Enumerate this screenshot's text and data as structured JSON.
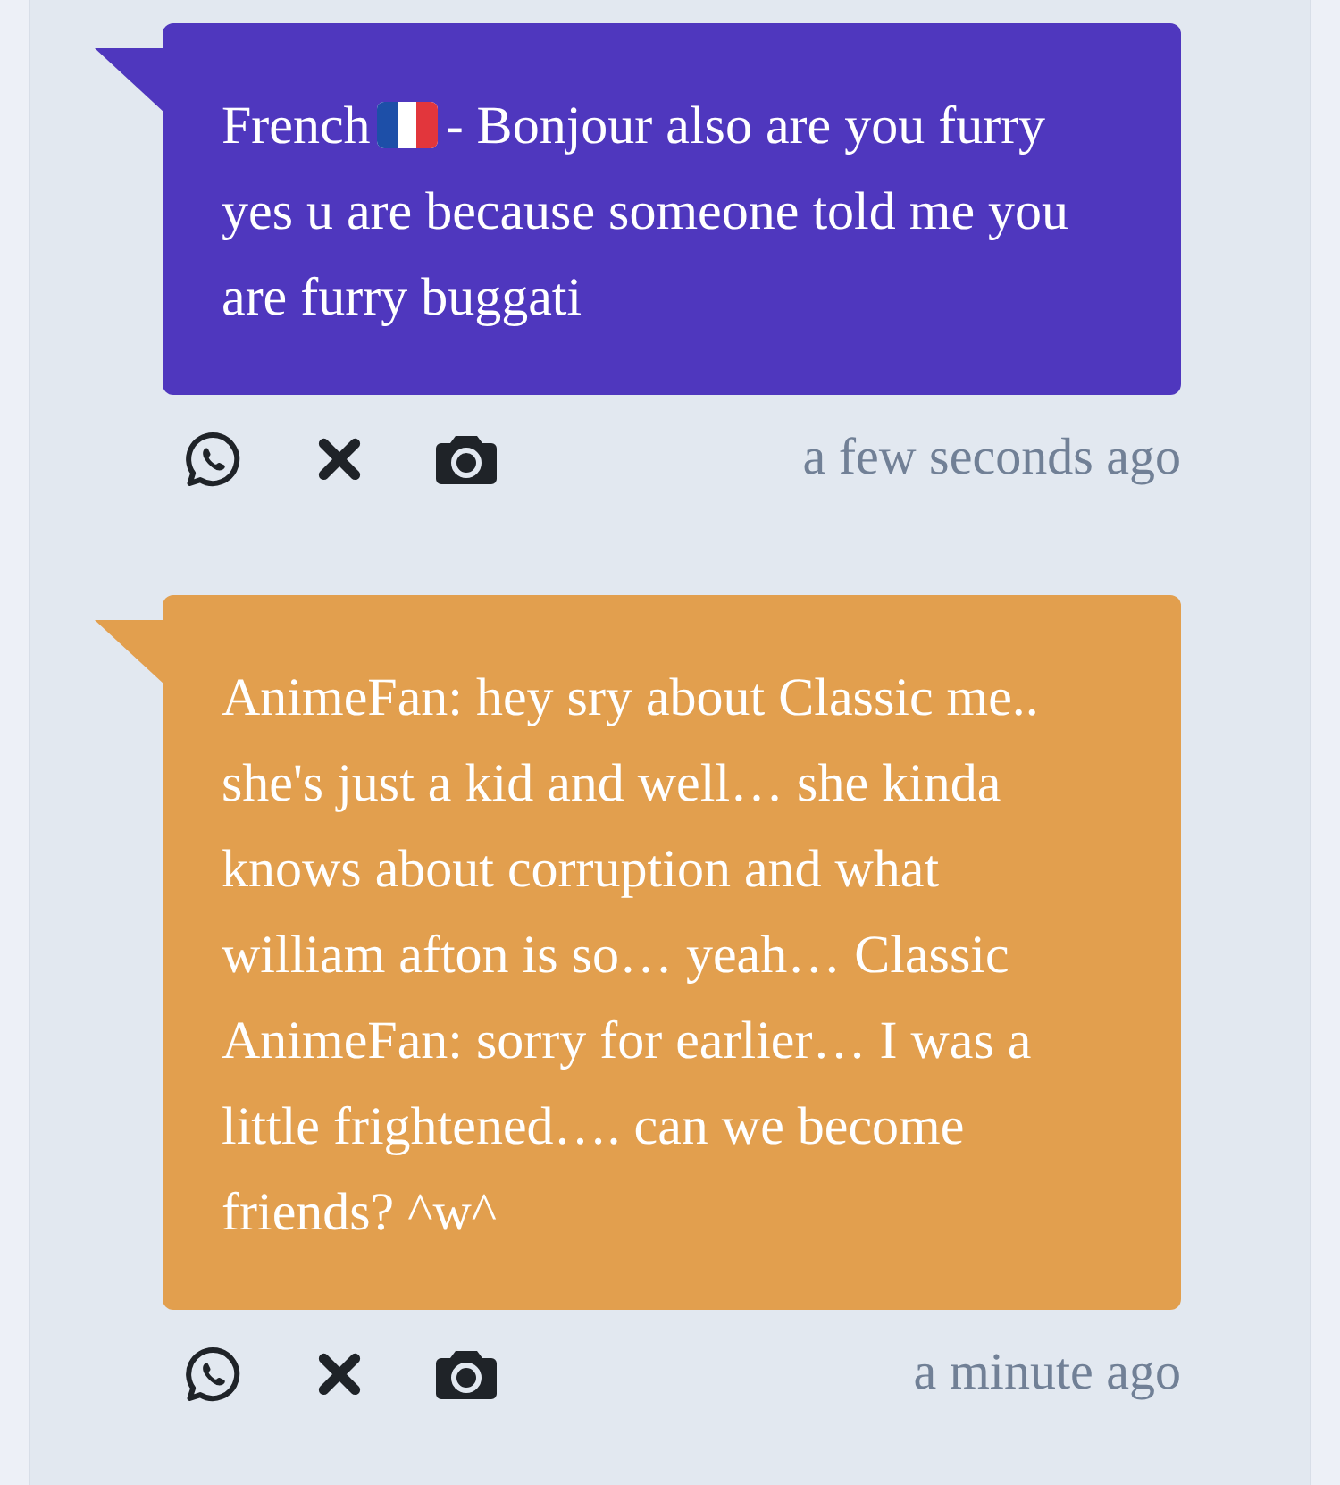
{
  "messages": [
    {
      "prefix": "French",
      "text": "- Bonjour also are you furry yes u are because someone told me you are furry buggati",
      "color": "#4f37be",
      "time": "a few seconds ago"
    },
    {
      "text": "AnimeFan: hey sry about Classic me.. she's just a kid and well… she kinda knows about corruption and what william afton is so… yeah… Classic AnimeFan: sorry for earlier… I was a little frightened…. can we become friends? ^w^",
      "color": "#e29f4e",
      "time": "a minute ago"
    }
  ]
}
